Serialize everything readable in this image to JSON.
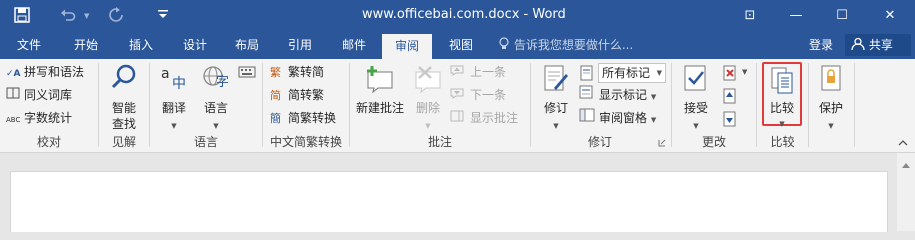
{
  "window": {
    "title": "www.officebai.com.docx - Word"
  },
  "titlebar": {
    "minimize_glyph": "—",
    "maximize_glyph": "☐",
    "close_glyph": "✕",
    "ribbon_display_glyph": "⊡"
  },
  "tabs": [
    {
      "label": "文件"
    },
    {
      "label": "开始"
    },
    {
      "label": "插入"
    },
    {
      "label": "设计"
    },
    {
      "label": "布局"
    },
    {
      "label": "引用"
    },
    {
      "label": "邮件"
    },
    {
      "label": "审阅",
      "active": true
    },
    {
      "label": "视图"
    }
  ],
  "tellme": {
    "placeholder": "告诉我您想要做什么..."
  },
  "account": {
    "login": "登录",
    "share": "共享"
  },
  "ribbon": {
    "proofing": {
      "spelling": "拼写和语法",
      "thesaurus": "同义词库",
      "wordcount": "字数统计",
      "label": "校对",
      "abc_tag": "ABC"
    },
    "insights": {
      "smartlookup_line1": "智能",
      "smartlookup_line2": "查找",
      "label": "见解"
    },
    "language": {
      "translate": "翻译",
      "language": "语言",
      "label": "语言"
    },
    "chinese": {
      "to_traditional": "繁转简",
      "to_simplified": "简转繁",
      "conversion": "简繁转换",
      "label": "中文简繁转换"
    },
    "comments": {
      "new": "新建批注",
      "delete": "删除",
      "previous": "上一条",
      "next": "下一条",
      "show": "显示批注",
      "label": "批注"
    },
    "tracking": {
      "track": "修订",
      "markup_select": "所有标记",
      "show_markup": "显示标记",
      "pane": "审阅窗格",
      "label": "修订"
    },
    "changes": {
      "accept": "接受",
      "label": "更改"
    },
    "compare": {
      "compare": "比较",
      "label": "比较"
    },
    "protect": {
      "protect": "保护"
    }
  }
}
